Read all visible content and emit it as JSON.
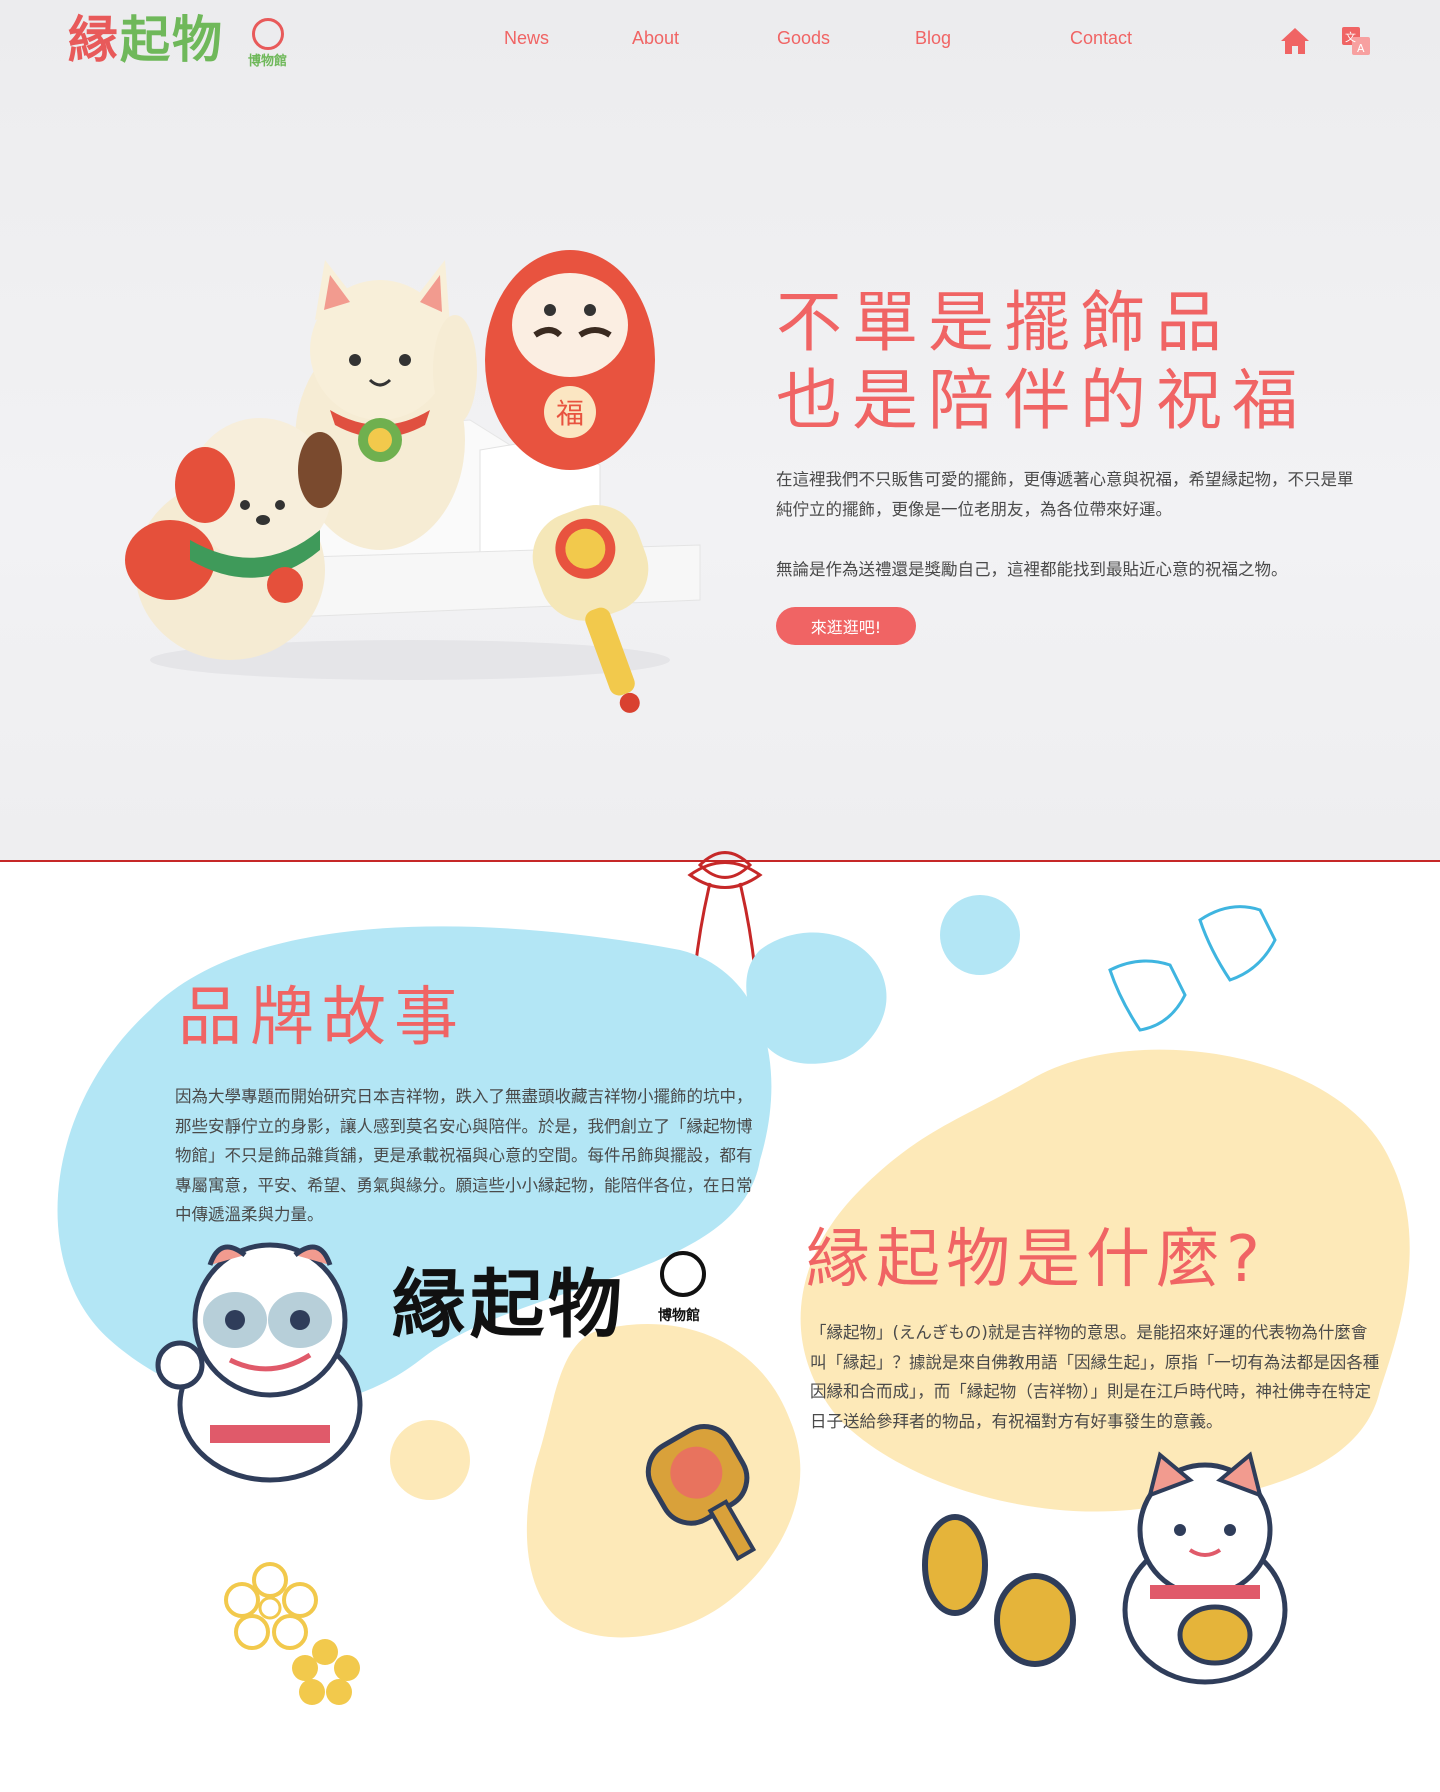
{
  "nav": {
    "logo_text": "縁起物",
    "logo_sub": "博物館",
    "links": [
      "News",
      "About",
      "Goods",
      "Blog",
      "Contact"
    ],
    "home_icon": "home-icon",
    "lang_icon": "translate-icon"
  },
  "hero": {
    "title_line1": "不單是擺飾品",
    "title_line2": "也是陪伴的祝福",
    "para1": "在這裡我們不只販售可愛的擺飾，更傳遞著心意與祝福，希望縁起物，不只是單純佇立的擺飾，更像是一位老朋友，為各位帶來好運。",
    "para2": "無論是作為送禮還是獎勵自己，這裡都能找到最貼近心意的祝福之物。",
    "cta": "來逛逛吧!",
    "daruma_label": "福"
  },
  "story": {
    "title": "品牌故事",
    "body": "因為大學專題而開始研究日本吉祥物，跌入了無盡頭收藏吉祥物小擺飾的坑中，那些安靜佇立的身影，讓人感到莫名安心與陪伴。於是，我們創立了「縁起物博物館」不只是飾品雜貨舖，更是承載祝福與心意的空間。每件吊飾與擺設，都有專屬寓意，平安、希望、勇氣與緣分。願這些小小縁起物，能陪伴各位，在日常中傳遞溫柔與力量。",
    "logo_text": "縁起物",
    "logo_sub": "博物館"
  },
  "what": {
    "title": "縁起物是什麼?",
    "body": "「縁起物」(えんぎもの)就是吉祥物的意思。是能招來好運的代表物為什麼會叫「縁起」？據說是來自佛教用語「因縁生起」，原指「一切有為法都是因各種因縁和合而成」，而「縁起物（吉祥物）」則是在江戶時代時，神社佛寺在特定日子送給參拜者的物品，有祝福對方有好事發生的意義。"
  },
  "colors": {
    "accent": "#f06464",
    "green": "#6fb85a",
    "blue_blob": "#b3e6f5",
    "yellow_blob": "#fde9b8",
    "divider": "#c62828"
  }
}
